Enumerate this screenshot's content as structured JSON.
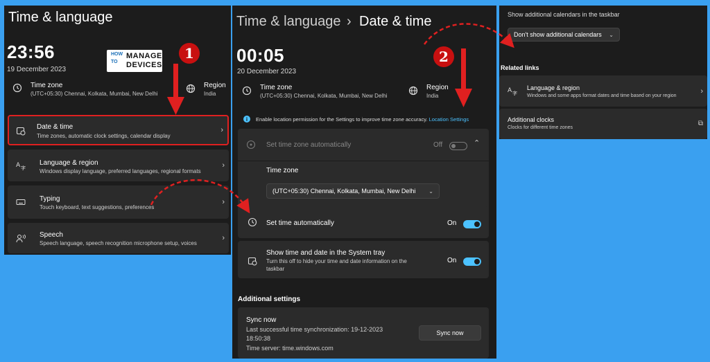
{
  "panel1": {
    "title": "Time & language",
    "clock": "23:56",
    "date": "19 December 2023",
    "logo": {
      "l1": "HOW",
      "l2": "TO",
      "l3": "MANAGE",
      "l4": "DEVICES"
    },
    "timezone_label": "Time zone",
    "timezone_value": "(UTC+05:30) Chennai, Kolkata, Mumbai, New Delhi",
    "region_label": "Region",
    "region_value": "India",
    "badge": "1",
    "items": [
      {
        "title": "Date & time",
        "desc": "Time zones, automatic clock settings, calendar display"
      },
      {
        "title": "Language & region",
        "desc": "Windows display language, preferred languages, regional formats"
      },
      {
        "title": "Typing",
        "desc": "Touch keyboard, text suggestions, preferences"
      },
      {
        "title": "Speech",
        "desc": "Speech language, speech recognition microphone setup, voices"
      }
    ]
  },
  "panel2": {
    "breadcrumb_parent": "Time & language",
    "breadcrumb_sep": "›",
    "breadcrumb_current": "Date & time",
    "clock": "00:05",
    "date": "20 December 2023",
    "timezone_label": "Time zone",
    "timezone_value": "(UTC+05:30) Chennai, Kolkata, Mumbai, New Delhi",
    "region_label": "Region",
    "region_value": "India",
    "badge": "2",
    "info_text": "Enable location permission for the Settings to improve time zone accuracy.",
    "info_link": "Location Settings",
    "auto_tz_label": "Set time zone automatically",
    "auto_tz_state": "Off",
    "tz_section_label": "Time zone",
    "tz_select_value": "(UTC+05:30) Chennai, Kolkata, Mumbai, New Delhi",
    "set_time_auto_label": "Set time automatically",
    "set_time_auto_state": "On",
    "tray_label": "Show time and date in the System tray",
    "tray_desc_1": "Turn this off to hide your time and date information on the",
    "tray_desc_2": "taskbar",
    "tray_state": "On",
    "additional_heading": "Additional settings",
    "sync_title": "Sync now",
    "sync_last": "Last successful time synchronization: 19-12-2023",
    "sync_time": "18:50:38",
    "sync_server": "Time server: time.windows.com",
    "sync_button": "Sync now"
  },
  "panel3": {
    "calendars_label": "Show additional calendars in the taskbar",
    "calendars_select": "Don't show additional calendars",
    "related_heading": "Related links",
    "lang_title": "Language & region",
    "lang_desc": "Windows and some apps format dates and time based on your region",
    "clocks_title": "Additional clocks",
    "clocks_desc": "Clocks for different time zones"
  },
  "colors": {
    "accent": "#4cc2ff",
    "badge": "#c81010",
    "highlight": "#e02020",
    "background": "#3aa0f0"
  }
}
